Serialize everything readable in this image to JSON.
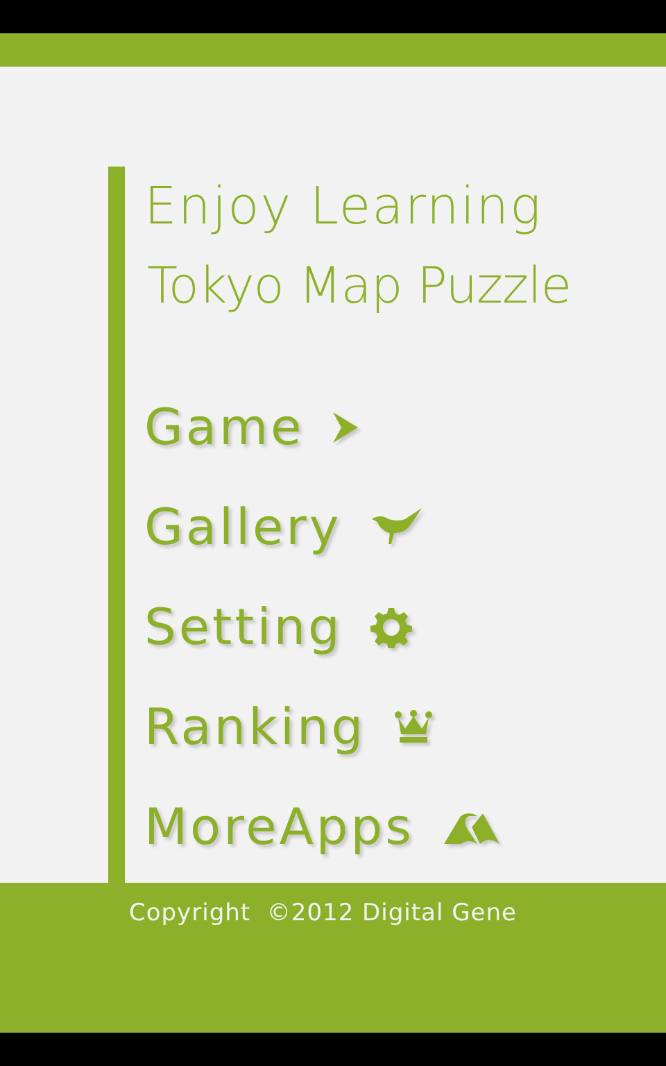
{
  "title": {
    "lines": [
      "Enjoy Learning",
      "Tokyo Map Puzzle"
    ]
  },
  "menu": [
    {
      "label": "Game"
    },
    {
      "label": "Gallery"
    },
    {
      "label": "Setting"
    },
    {
      "label": "Ranking"
    },
    {
      "label": "MoreApps"
    }
  ],
  "footer": {
    "copyright": "Copyright  ©2012 Digital Gene"
  }
}
